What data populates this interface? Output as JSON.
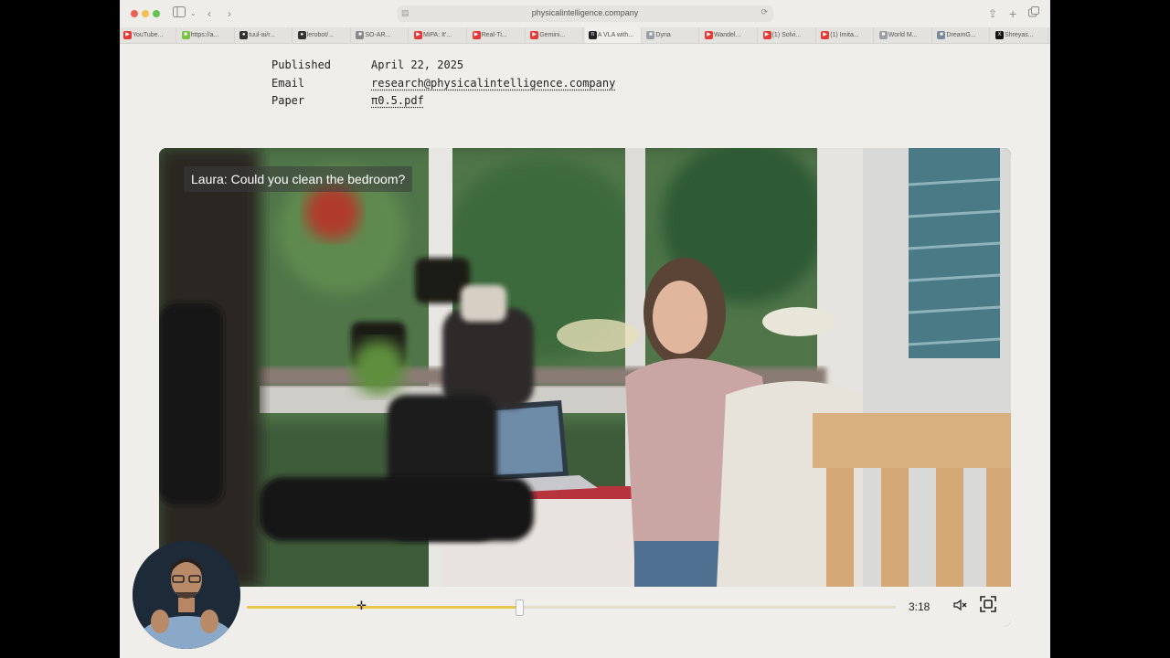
{
  "browser": {
    "address": "physicalintelligence.company",
    "tabs": [
      {
        "label": "YouTube...",
        "fav": "youtube-icon",
        "color": "#e53935"
      },
      {
        "label": "https://a...",
        "fav": "site-icon",
        "color": "#7cc243"
      },
      {
        "label": "tuul-ai/r...",
        "fav": "github-icon",
        "color": "#333333"
      },
      {
        "label": "lerobot/...",
        "fav": "github-icon",
        "color": "#333333"
      },
      {
        "label": "SO-AR...",
        "fav": "site-icon",
        "color": "#888888"
      },
      {
        "label": "MiPA: It'...",
        "fav": "youtube-icon",
        "color": "#e53935"
      },
      {
        "label": "Real-Ti...",
        "fav": "youtube-icon",
        "color": "#e53935"
      },
      {
        "label": "Gemini...",
        "fav": "youtube-icon",
        "color": "#e53935"
      },
      {
        "label": "A VLA with...",
        "fav": "pi-icon",
        "color": "#222222"
      },
      {
        "label": "Dyna",
        "fav": "site-icon",
        "color": "#9aa0a6"
      },
      {
        "label": "Wandel...",
        "fav": "youtube-icon",
        "color": "#e53935"
      },
      {
        "label": "(1) Solvi...",
        "fav": "youtube-icon",
        "color": "#e53935"
      },
      {
        "label": "(1) Imita...",
        "fav": "youtube-icon",
        "color": "#e53935"
      },
      {
        "label": "World M...",
        "fav": "site-icon",
        "color": "#9aa0a6"
      },
      {
        "label": "DreamG...",
        "fav": "site-icon",
        "color": "#7a8a99"
      },
      {
        "label": "Shreyas...",
        "fav": "x-icon",
        "color": "#111111"
      }
    ],
    "active_tab": 8
  },
  "meta": {
    "published_label": "Published",
    "published_value": "April 22, 2025",
    "email_label": "Email",
    "email_value": "research@physicalintelligence.company",
    "paper_label": "Paper",
    "paper_value": "π0.5.pdf"
  },
  "video": {
    "caption": "Laura: Could you clean the bedroom?",
    "time": "3:18",
    "progress": 0.42
  },
  "colors": {
    "page_bg": "#efeeea",
    "progress_fill": "#e8c84a",
    "progress_track": "#e2dec8"
  }
}
